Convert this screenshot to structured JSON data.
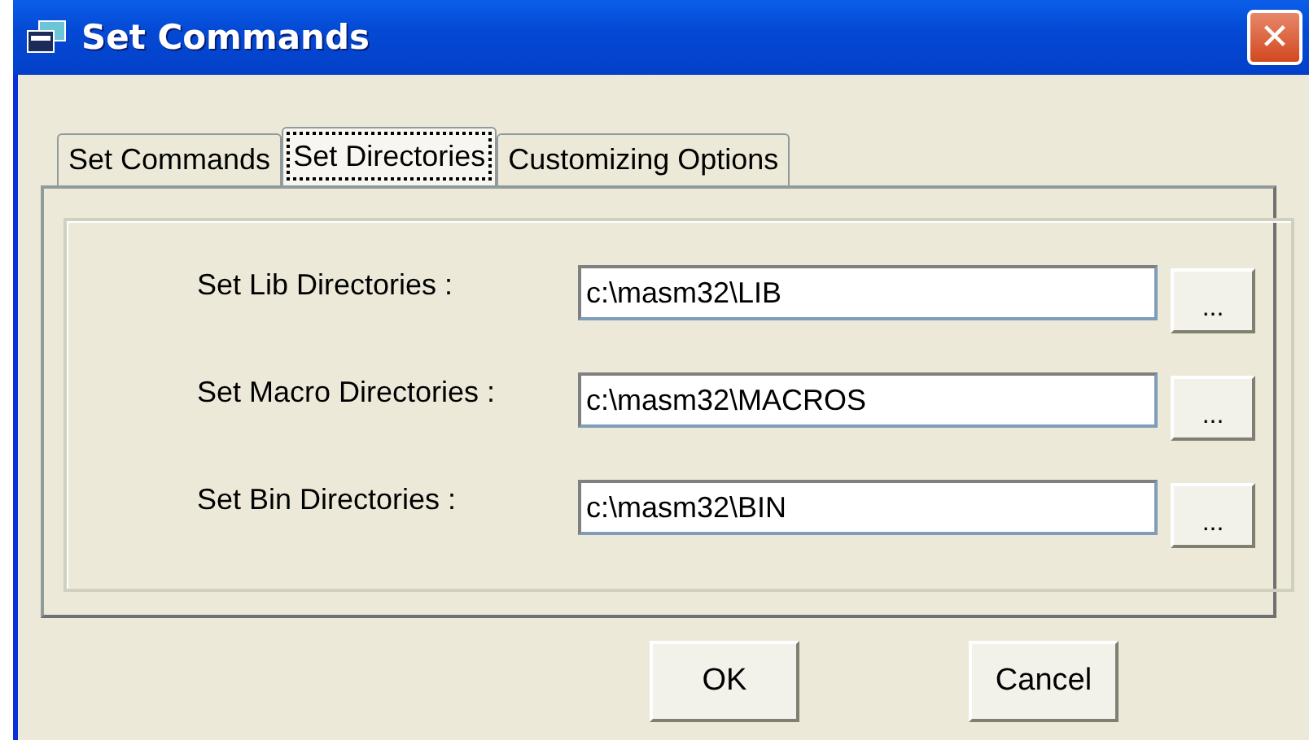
{
  "window": {
    "title": "Set Commands",
    "close": "✕"
  },
  "tabs": [
    {
      "label": "Set Commands",
      "selected": false
    },
    {
      "label": "Set Directories",
      "selected": true
    },
    {
      "label": "Customizing Options",
      "selected": false
    }
  ],
  "rows": [
    {
      "label": "Set Lib Directories :",
      "value": "c:\\masm32\\LIB",
      "browse": "..."
    },
    {
      "label": "Set Macro Directories :",
      "value": "c:\\masm32\\MACROS",
      "browse": "..."
    },
    {
      "label": "Set Bin Directories :",
      "value": "c:\\masm32\\BIN",
      "browse": "..."
    }
  ],
  "buttons": [
    "OK",
    "Cancel"
  ]
}
